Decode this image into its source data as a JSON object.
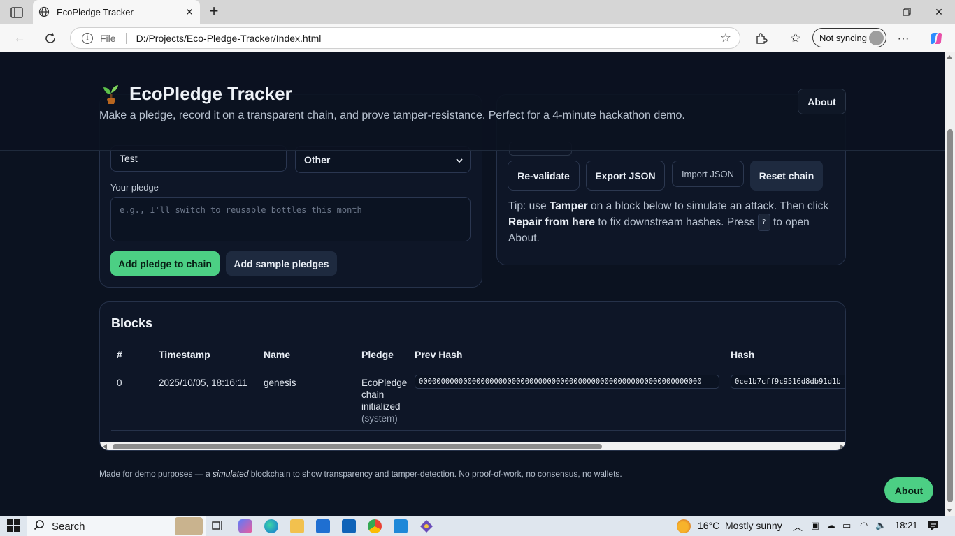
{
  "browser": {
    "tab_title": "EcoPledge Tracker",
    "address_scheme": "File",
    "address_url": "D:/Projects/Eco-Pledge-Tracker/Index.html",
    "sync_label": "Not syncing"
  },
  "app": {
    "title": "EcoPledge Tracker",
    "tagline": "Make a pledge, record it on a transparent chain, and prove tamper-resistance. Perfect for a 4-minute hackathon demo.",
    "about_label": "About"
  },
  "form": {
    "name_value": "Test",
    "category_value": "Other",
    "pledge_label": "Your pledge",
    "pledge_placeholder": "e.g., I'll switch to reusable bottles this month",
    "add_button": "Add pledge to chain",
    "sample_button": "Add sample pledges"
  },
  "controls": {
    "revalidate": "Re-validate",
    "export": "Export JSON",
    "import": "Import JSON",
    "reset": "Reset chain",
    "tip_prefix": "Tip: use",
    "tip_tamper": "Tamper",
    "tip_mid": "on a block below to simulate an attack. Then click",
    "tip_repair": "Repair from here",
    "tip_after": "to fix downstream hashes. Press",
    "tip_key": "?",
    "tip_end": "to open About."
  },
  "blocks": {
    "title": "Blocks",
    "columns": [
      "#",
      "Timestamp",
      "Name",
      "Pledge",
      "Prev Hash",
      "Hash"
    ],
    "rows": [
      {
        "index": "0",
        "timestamp": "2025/10/05, 18:16:11",
        "name": "genesis",
        "pledge_line1": "EcoPledge",
        "pledge_line2": "chain",
        "pledge_line3": "initialized",
        "pledge_category": "(system)",
        "prev_hash": "0000000000000000000000000000000000000000000000000000000000000000",
        "hash": "0ce1b7cff9c9516d8db91d1b"
      }
    ]
  },
  "footer": {
    "before": "Made for demo purposes — a",
    "emph": "simulated",
    "after": "blockchain to show transparency and tamper-detection. No proof-of-work, no consensus, no wallets.",
    "about_fab": "About"
  },
  "taskbar": {
    "search_label": "Search",
    "temperature": "16°C",
    "weather": "Mostly sunny",
    "time": "18:21"
  },
  "colors": {
    "accent_green": "#4ccf84",
    "page_bg": "#0b1220",
    "card_bg": "#0e1627"
  }
}
